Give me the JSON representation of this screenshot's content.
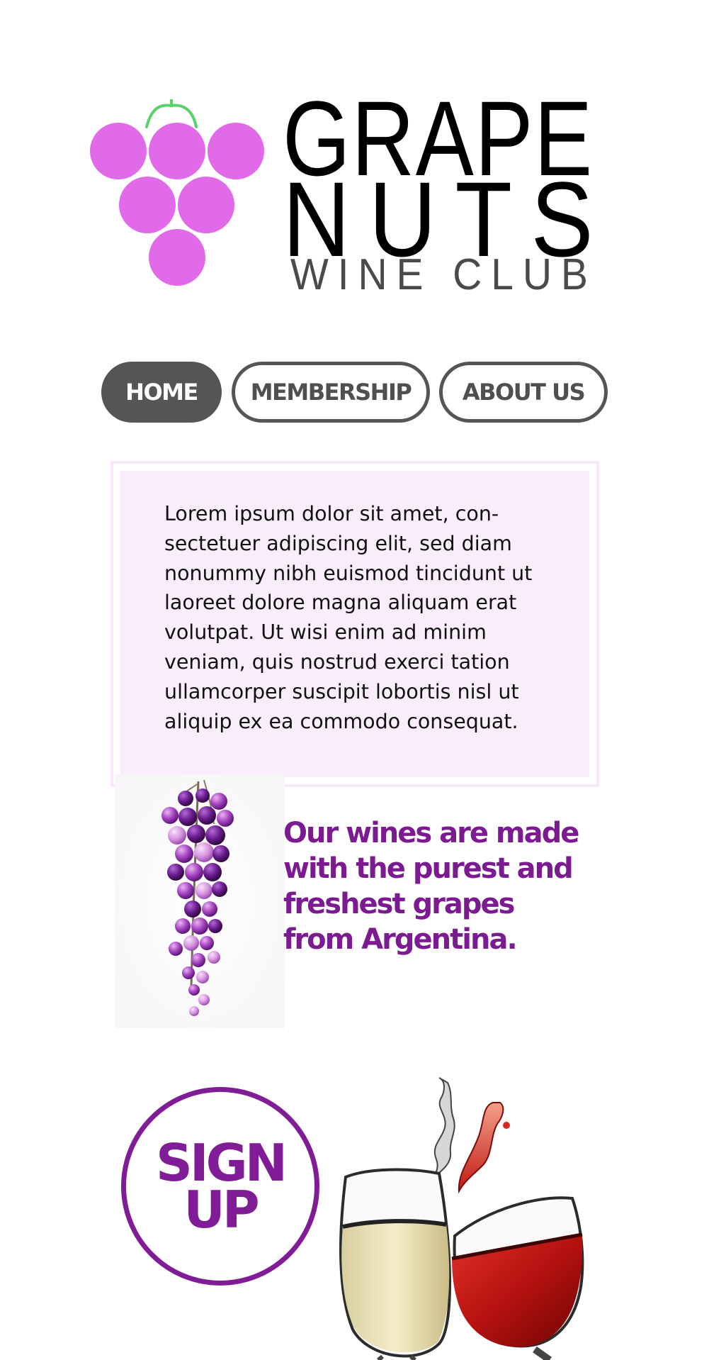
{
  "brand": {
    "line1": "GRAPE",
    "line2": "NUTS",
    "line3": "WINE CLUB",
    "logo_icon": "grape-cluster-icon",
    "grape_color": "#e06ae8",
    "stem_color": "#58d26a"
  },
  "nav": {
    "items": [
      {
        "label": "HOME",
        "active": true
      },
      {
        "label": "MEMBERSHIP",
        "active": false
      },
      {
        "label": "ABOUT US",
        "active": false
      }
    ]
  },
  "content": {
    "body": "Lorem ipsum dolor sit amet, con­sectetuer adipiscing elit, sed diam nonummy nibh euismod tincidunt ut laoreet dolore magna aliquam erat volutpat. Ut wisi enim ad minim veniam, quis nostrud exerci tation ullamcorper suscipit lobortis nisl ut aliquip ex ea commodo consequat."
  },
  "feature": {
    "tagline": "Our wines are made with the purest and freshest grapes from Argentina.",
    "image": "grape-bunch-photo"
  },
  "signup": {
    "line1": "SIGN",
    "line2": "UP",
    "color": "#7f1c96"
  },
  "hero_image": "wine-glasses-toast-photo"
}
